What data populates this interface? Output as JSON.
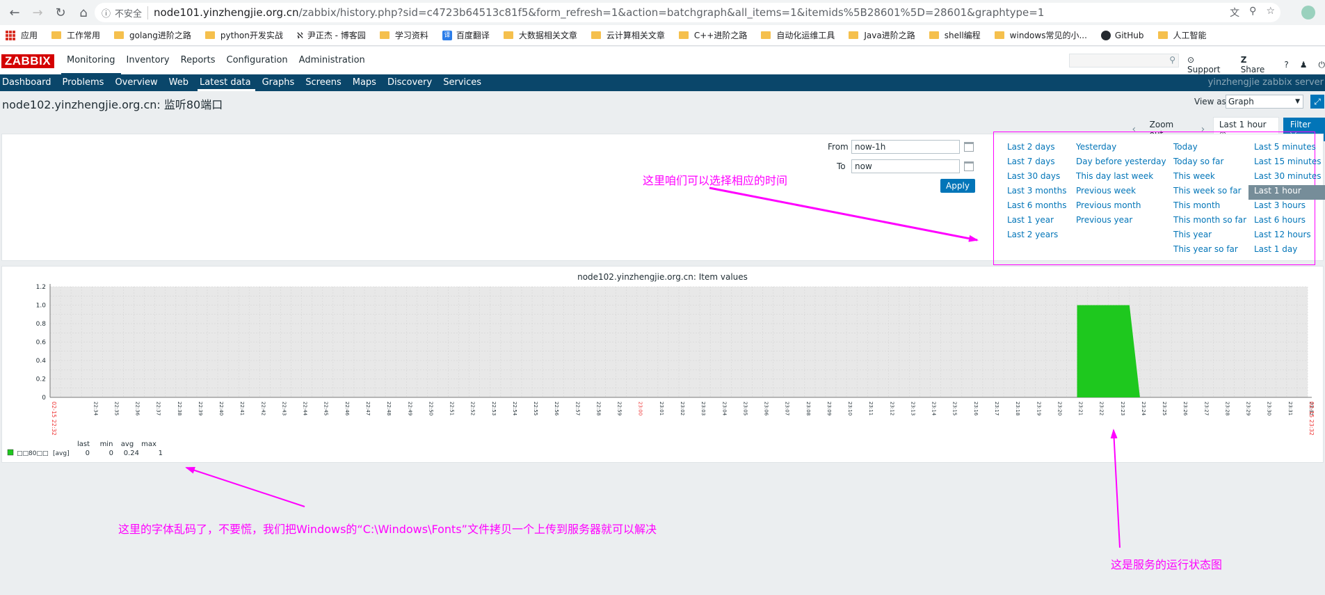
{
  "browser": {
    "insecure_label": "不安全",
    "url_host": "node101.yinzhengjie.org.cn",
    "url_rest": "/zabbix/history.php?sid=c4723b64513c81f5&form_refresh=1&action=batchgraph&all_items=1&itemids%5B28601%5D=28601&graphtype=1"
  },
  "bookmarks": [
    {
      "label": "应用",
      "icon": "apps-icon"
    },
    {
      "label": "工作常用",
      "icon": "folder-icon"
    },
    {
      "label": "golang进阶之路",
      "icon": "folder-icon"
    },
    {
      "label": "python开发实战",
      "icon": "folder-icon"
    },
    {
      "label": "尹正杰 - 博客园",
      "icon": "blog-icon"
    },
    {
      "label": "学习资料",
      "icon": "folder-icon"
    },
    {
      "label": "百度翻译",
      "icon": "translate-icon"
    },
    {
      "label": "大数据相关文章",
      "icon": "folder-icon"
    },
    {
      "label": "云计算相关文章",
      "icon": "folder-icon"
    },
    {
      "label": "C++进阶之路",
      "icon": "folder-icon"
    },
    {
      "label": "自动化运维工具",
      "icon": "folder-icon"
    },
    {
      "label": "Java进阶之路",
      "icon": "folder-icon"
    },
    {
      "label": "shell编程",
      "icon": "folder-icon"
    },
    {
      "label": "windows常见的小...",
      "icon": "folder-icon"
    },
    {
      "label": "GitHub",
      "icon": "github-icon"
    },
    {
      "label": "人工智能",
      "icon": "folder-icon"
    }
  ],
  "header": {
    "logo": "ZABBIX",
    "main_menu": [
      "Monitoring",
      "Inventory",
      "Reports",
      "Configuration",
      "Administration"
    ],
    "support": "Support",
    "share": "Share",
    "help": "?"
  },
  "sub_menu": [
    "Dashboard",
    "Problems",
    "Overview",
    "Web",
    "Latest data",
    "Graphs",
    "Screens",
    "Maps",
    "Discovery",
    "Services"
  ],
  "server_name": "yinzhengjie zabbix server",
  "page": {
    "title": "node102.yinzhengjie.org.cn: 监听80端口",
    "view_as_label": "View as",
    "view_as_value": "Graph"
  },
  "time_nav": {
    "zoom_out": "Zoom out",
    "active_range": "Last 1 hour",
    "filter": "Filter"
  },
  "filter": {
    "from_label": "From",
    "from_value": "now-1h",
    "to_label": "To",
    "to_value": "now",
    "apply": "Apply",
    "quick_ranges": [
      [
        "Last 2 days",
        "Last 7 days",
        "Last 30 days",
        "Last 3 months",
        "Last 6 months",
        "Last 1 year",
        "Last 2 years"
      ],
      [
        "Yesterday",
        "Day before yesterday",
        "This day last week",
        "Previous week",
        "Previous month",
        "Previous year"
      ],
      [
        "Today",
        "Today so far",
        "This week",
        "This week so far",
        "This month",
        "This month so far",
        "This year",
        "This year so far"
      ],
      [
        "Last 5 minutes",
        "Last 15 minutes",
        "Last 30 minutes",
        "Last 1 hour",
        "Last 3 hours",
        "Last 6 hours",
        "Last 12 hours",
        "Last 1 day"
      ]
    ],
    "selected": "Last 1 hour"
  },
  "graph": {
    "title": "node102.yinzhengjie.org.cn: Item values",
    "legend_headers": [
      "last",
      "min",
      "avg",
      "max"
    ],
    "legend_name": "□□80□□",
    "legend_func": "[avg]",
    "legend_values": [
      "0",
      "0",
      "0.24",
      "1"
    ],
    "legend_color": "#1ec81e",
    "start_label": "02-15 22:32",
    "end_label": "02-15 23:32"
  },
  "chart_data": {
    "type": "area",
    "title": "node102.yinzhengjie.org.cn: Item values",
    "ylim": [
      0,
      1.2
    ],
    "y_ticks": [
      "0",
      "0.2",
      "0.4",
      "0.6",
      "0.8",
      "1.0",
      "1.2"
    ],
    "x_ticks": [
      "22:34",
      "22:35",
      "22:36",
      "22:37",
      "22:38",
      "22:39",
      "22:40",
      "22:41",
      "22:42",
      "22:43",
      "22:44",
      "22:45",
      "22:46",
      "22:47",
      "22:48",
      "22:49",
      "22:50",
      "22:51",
      "22:52",
      "22:53",
      "22:54",
      "22:55",
      "22:56",
      "22:57",
      "22:58",
      "22:59",
      "23:00",
      "23:01",
      "23:02",
      "23:03",
      "23:04",
      "23:05",
      "23:06",
      "23:07",
      "23:08",
      "23:09",
      "23:10",
      "23:11",
      "23:12",
      "23:13",
      "23:14",
      "23:15",
      "23:16",
      "23:17",
      "23:18",
      "23:19",
      "23:20",
      "23:21",
      "23:22",
      "23:23",
      "23:24",
      "23:25",
      "23:26",
      "23:27",
      "23:28",
      "23:29",
      "23:30",
      "23:31",
      "23:32"
    ],
    "highlight_tick": "23:00",
    "series": [
      {
        "name": "□□80□□",
        "color": "#1ec81e",
        "points": [
          [
            22.32,
            0
          ],
          [
            49.0,
            0
          ],
          [
            49.0,
            1
          ],
          [
            51.5,
            1
          ],
          [
            52.0,
            0
          ],
          [
            60.0,
            0
          ]
        ]
      }
    ],
    "x_range_minutes": [
      0,
      60
    ],
    "grid": true
  },
  "annotations": {
    "time_note": "这里咱们可以选择相应的时间",
    "font_note": "这里的字体乱码了，不要慌，我们把Windows的“C:\\Windows\\Fonts”文件拷贝一个上传到服务器就可以解决",
    "status_note": "这是服务的运行状态图"
  }
}
